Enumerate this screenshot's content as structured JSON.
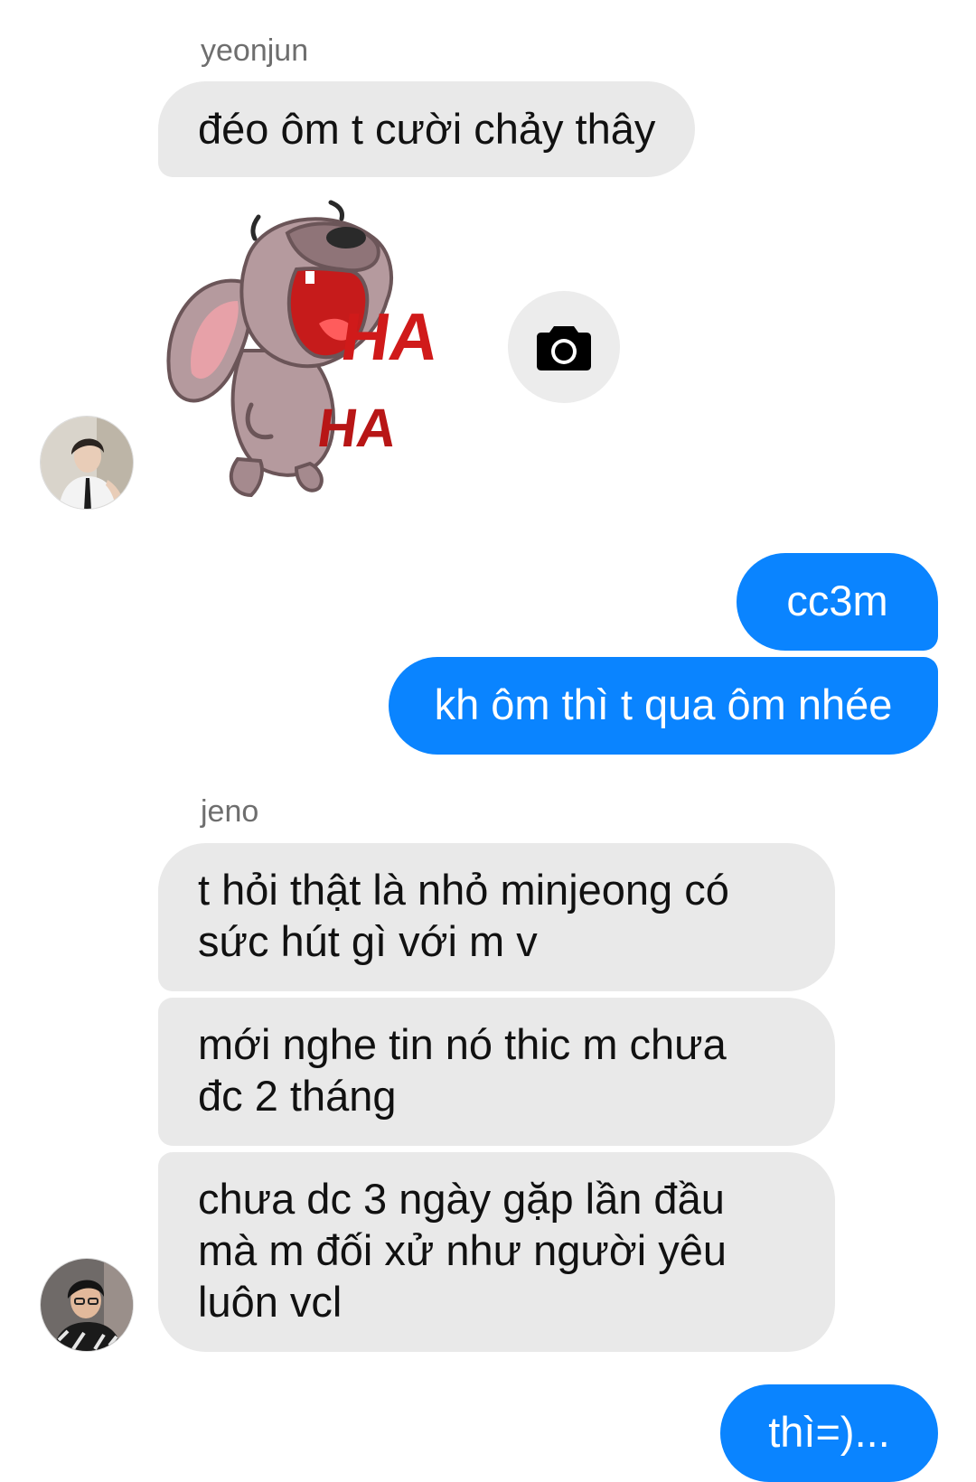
{
  "conversation": {
    "group1": {
      "sender": "yeonjun",
      "avatar_icon": "profile-photo-yeonjun",
      "message1": "đéo ôm t cười chảy thây",
      "sticker": {
        "icon": "laughing-dog-sticker",
        "text_line1": "HA",
        "text_line2": "HA"
      },
      "camera_icon": "camera-icon"
    },
    "outgoing1": {
      "message1": "cc3m",
      "message2": "kh ôm thì t qua ôm nhée"
    },
    "group2": {
      "sender": "jeno",
      "avatar_icon": "profile-photo-jeno",
      "message1_line1": "t hỏi thật là nhỏ minjeong có",
      "message1_line2": "sức hút gì với m v",
      "message2_line1": "mới nghe tin nó thic m chưa",
      "message2_line2": "đc 2 tháng",
      "message3_line1": "chưa dc 3 ngày gặp lần đầu",
      "message3_line2": "mà m đối xử như người yêu",
      "message3_line3": "luôn vcl"
    },
    "outgoing2": {
      "message1": "thì=)..."
    }
  },
  "colors": {
    "outgoing_bubble": "#0a84ff",
    "incoming_bubble": "#e9e9e9",
    "sender_name": "#6e6e6e"
  }
}
